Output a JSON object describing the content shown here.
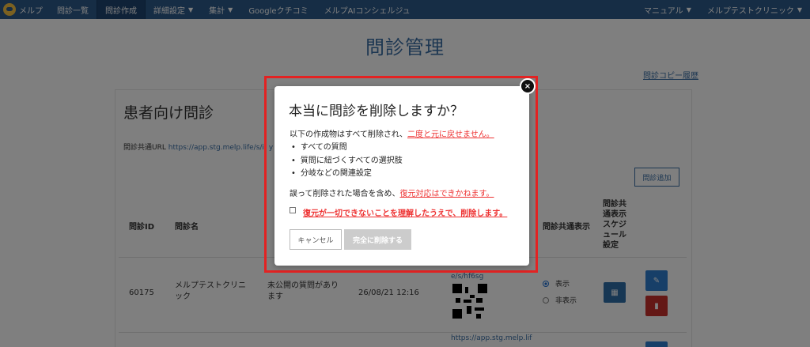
{
  "navbar": {
    "brand": "メルプ",
    "items": [
      {
        "label": "問診一覧",
        "caret": false
      },
      {
        "label": "問診作成",
        "caret": false,
        "active": true
      },
      {
        "label": "詳細設定",
        "caret": true
      },
      {
        "label": "集計",
        "caret": true
      },
      {
        "label": "Googleクチコミ",
        "caret": false
      },
      {
        "label": "メルプAIコンシェルジュ",
        "caret": false
      }
    ],
    "right_items": [
      {
        "label": "マニュアル"
      },
      {
        "label": "メルプテストクリニック"
      }
    ],
    "colors": {
      "bg": "#2c5a8a",
      "active": "#1e4570"
    }
  },
  "page": {
    "title": "問診管理",
    "history_link": "問診コピー履歴"
  },
  "panel": {
    "title": "患者向け問診",
    "share_url_label": "問診共通URL",
    "share_url": "https://app.stg.melp.life/s/i/ y",
    "add_button": "問診追加"
  },
  "table": {
    "headers": {
      "id": "問診ID",
      "name": "問診名",
      "display": "問診共通表示",
      "schedule": "問診共\n通表示\nスケジ\nュール\n設定"
    },
    "row": {
      "id": "60175",
      "name_line1": "メルプテストクリニ",
      "name_line2": "ック",
      "status_line1": "未公開の質問があり",
      "status_line2": "ます",
      "date": "26/08/21 12:16",
      "url_fragment": "e/s/hf6sg",
      "radio_show": "表示",
      "radio_hide": "非表示"
    },
    "next_url": "https://app.stg.melp.lif"
  },
  "modal": {
    "title": "本当に問診を削除しますか？",
    "intro_text": "以下の作成物はすべて削除され、",
    "intro_warn": "二度と元に戻せません。",
    "bullets": [
      "すべての質問",
      "質問に紐づくすべての選択肢",
      "分岐などの関連設定"
    ],
    "note_text": "誤って削除された場合を含め、",
    "note_warn": "復元対応はできかねます。",
    "confirm_label": "復元が一切できないことを理解したうえで、削除します。",
    "cancel_label": "キャンセル",
    "delete_label": "完全に削除する",
    "close_symbol": "×",
    "colors": {
      "warn": "#e33333",
      "highlight": "#e32222"
    }
  }
}
